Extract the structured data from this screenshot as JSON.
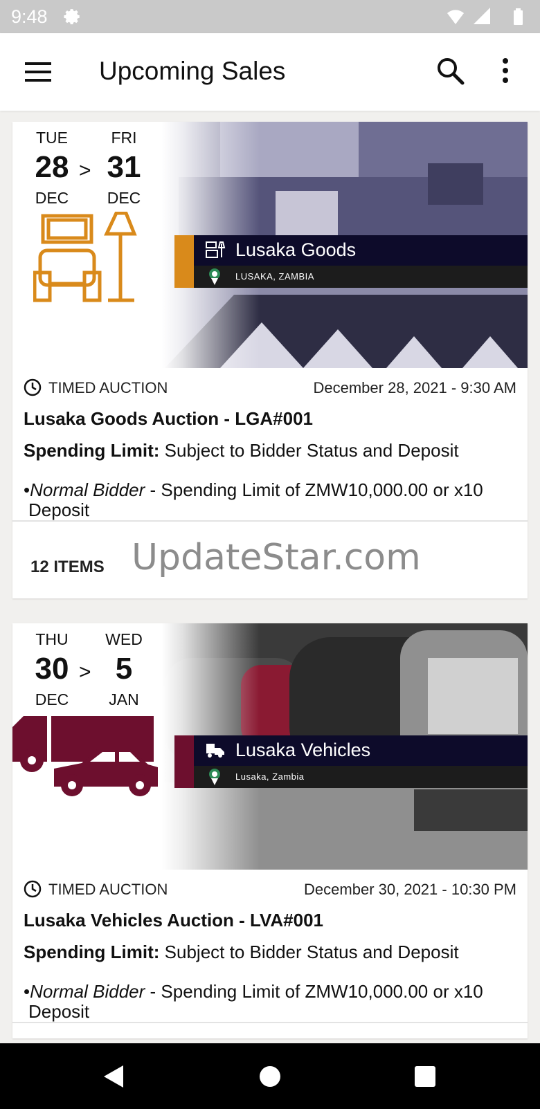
{
  "status_bar": {
    "time": "9:48"
  },
  "app_bar": {
    "title": "Upcoming Sales"
  },
  "auctions": [
    {
      "start": {
        "dow": "TUE",
        "day": "28",
        "month": "DEC"
      },
      "end": {
        "dow": "FRI",
        "day": "31",
        "month": "DEC"
      },
      "arrow": ">",
      "category": "Lusaka Goods",
      "location": "LUSAKA, ZAMBIA",
      "accent_color": "#d98a1b",
      "type": "TIMED AUCTION",
      "datetime": "December 28, 2021 - 9:30 AM",
      "name": "Lusaka Goods Auction - LGA#001",
      "spending_label": "Spending Limit:",
      "spending_text": "Subject to Bidder Status and Deposit",
      "bidder_bullet": "•",
      "bidder_type": "Normal Bidder",
      "bidder_text": " - Spending Limit of ZMW10,000.00 or x10",
      "bidder_text2": "Deposit",
      "items_count": "12 ITEMS"
    },
    {
      "start": {
        "dow": "THU",
        "day": "30",
        "month": "DEC"
      },
      "end": {
        "dow": "WED",
        "day": "5",
        "month": "JAN"
      },
      "arrow": ">",
      "category": "Lusaka Vehicles",
      "location": "Lusaka, Zambia",
      "accent_color": "#6d0f2e",
      "type": "TIMED AUCTION",
      "datetime": "December 30, 2021 - 10:30 PM",
      "name": "Lusaka Vehicles Auction - LVA#001",
      "spending_label": "Spending Limit:",
      "spending_text": "Subject to Bidder Status and Deposit",
      "bidder_bullet": "•",
      "bidder_type": "Normal Bidder",
      "bidder_text": " - Spending Limit of ZMW10,000.00 or x10",
      "bidder_text2": "Deposit"
    }
  ],
  "watermark": "UpdateStar.com",
  "icons": {
    "status": [
      "gear-icon",
      "wifi-icon",
      "signal-icon",
      "battery-icon"
    ],
    "app_bar": [
      "menu-icon",
      "search-icon",
      "more-vert-icon"
    ],
    "nav": [
      "back-icon",
      "home-icon",
      "recents-icon"
    ]
  }
}
